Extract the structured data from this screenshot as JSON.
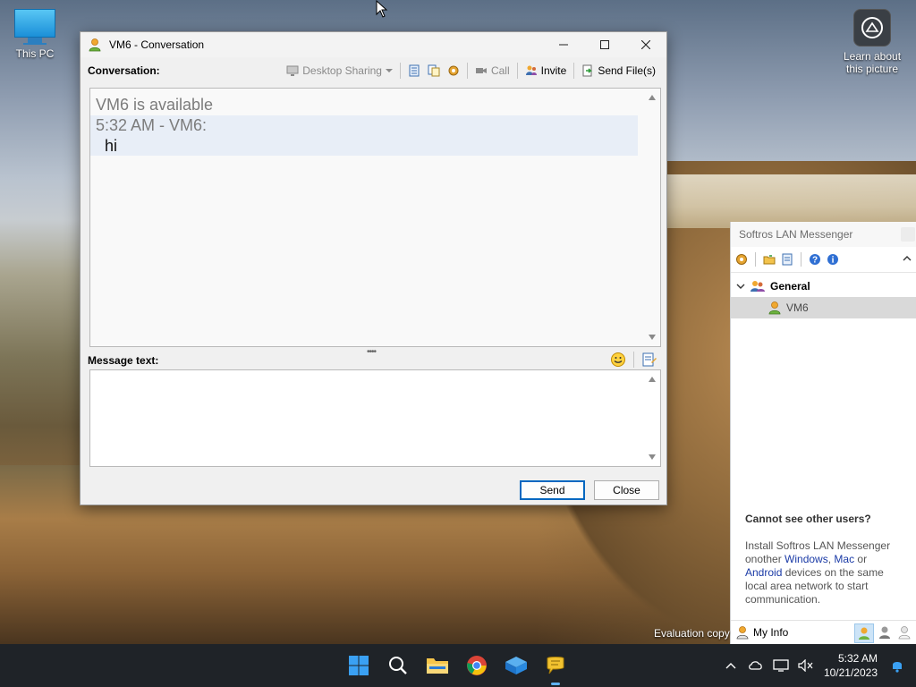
{
  "desktop": {
    "this_pc_label": "This PC",
    "learn_label": "Learn about this picture",
    "evaluation_text": "Evaluation copy"
  },
  "conversation": {
    "window_title": "VM6 - Conversation",
    "conversation_label": "Conversation:",
    "toolbar": {
      "desktop_sharing": "Desktop Sharing",
      "call": "Call",
      "invite": "Invite",
      "send_files": "Send File(s)"
    },
    "history": {
      "status_line": "VM6 is available",
      "message_header": "5:32 AM - VM6:",
      "message_text": "hi"
    },
    "message_label": "Message text:",
    "splitter_glyph": "••••",
    "send_label": "Send",
    "close_label": "Close"
  },
  "messenger": {
    "title": "Softros LAN Messenger",
    "group_name": "General",
    "user_name": "VM6",
    "help_title": "Cannot see other users?",
    "help_text_1": "Install Softros LAN Messenger onother ",
    "help_link_1": "Windows",
    "help_text_2": ", ",
    "help_link_2": "Mac",
    "help_text_3": " or ",
    "help_link_3": "Android",
    "help_text_4": " devices on the same local area network to start communication.",
    "my_info": "My Info"
  },
  "taskbar": {
    "time": "5:32 AM",
    "date": "10/21/2023"
  },
  "colors": {
    "accent": "#0067c0",
    "taskbar": "#1f2328",
    "link": "#1a3aa6"
  }
}
